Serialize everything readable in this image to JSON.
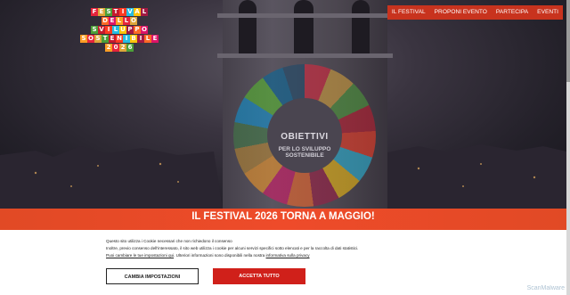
{
  "logo": {
    "rows": [
      "FESTIVAL",
      "DELLO",
      "SVILUPPO",
      "SOSTENIBILE",
      "2026"
    ],
    "colors": [
      "#e5243b",
      "#dda63a",
      "#4c9f38",
      "#c5192d",
      "#ff3a21",
      "#26bde2",
      "#fcc30b",
      "#a21942",
      "#fd6925",
      "#dd1367",
      "#fd9d24"
    ]
  },
  "nav": {
    "items": [
      "IL FESTIVAL",
      "PROPONI EVENTO",
      "PARTECIPA",
      "EVENTI"
    ],
    "background": "#c8331e"
  },
  "hero": {
    "projection_title": "OBIETTIVI",
    "projection_subtitle": "PER LO SVILUPPO\nSOSTENIBILE"
  },
  "banner": {
    "text": "IL FESTIVAL 2026 TORNA A MAGGIO!",
    "color": "#e8492a"
  },
  "cookie": {
    "line1": "Questo sito utilizza i Cookie necessari che non richiedono il consenso",
    "line2": "Inoltre, previo consenso dell'interessato, il sito web utilizza i cookie per alcuni servizi specifici sotto elencati e per la raccolta di dati statistici.",
    "line3_link": "Puoi cambiare le tue impostazioni qui",
    "line3_text": ". Ulteriori informazioni sono disponibili nella nostra ",
    "line3_link2": "informativa sulla privacy",
    "settings_button": "CAMBIA IMPOSTAZIONI",
    "accept_button": "ACCETTA TUTTO",
    "accept_color": "#d0201a"
  },
  "watermark": "ScanMalware"
}
